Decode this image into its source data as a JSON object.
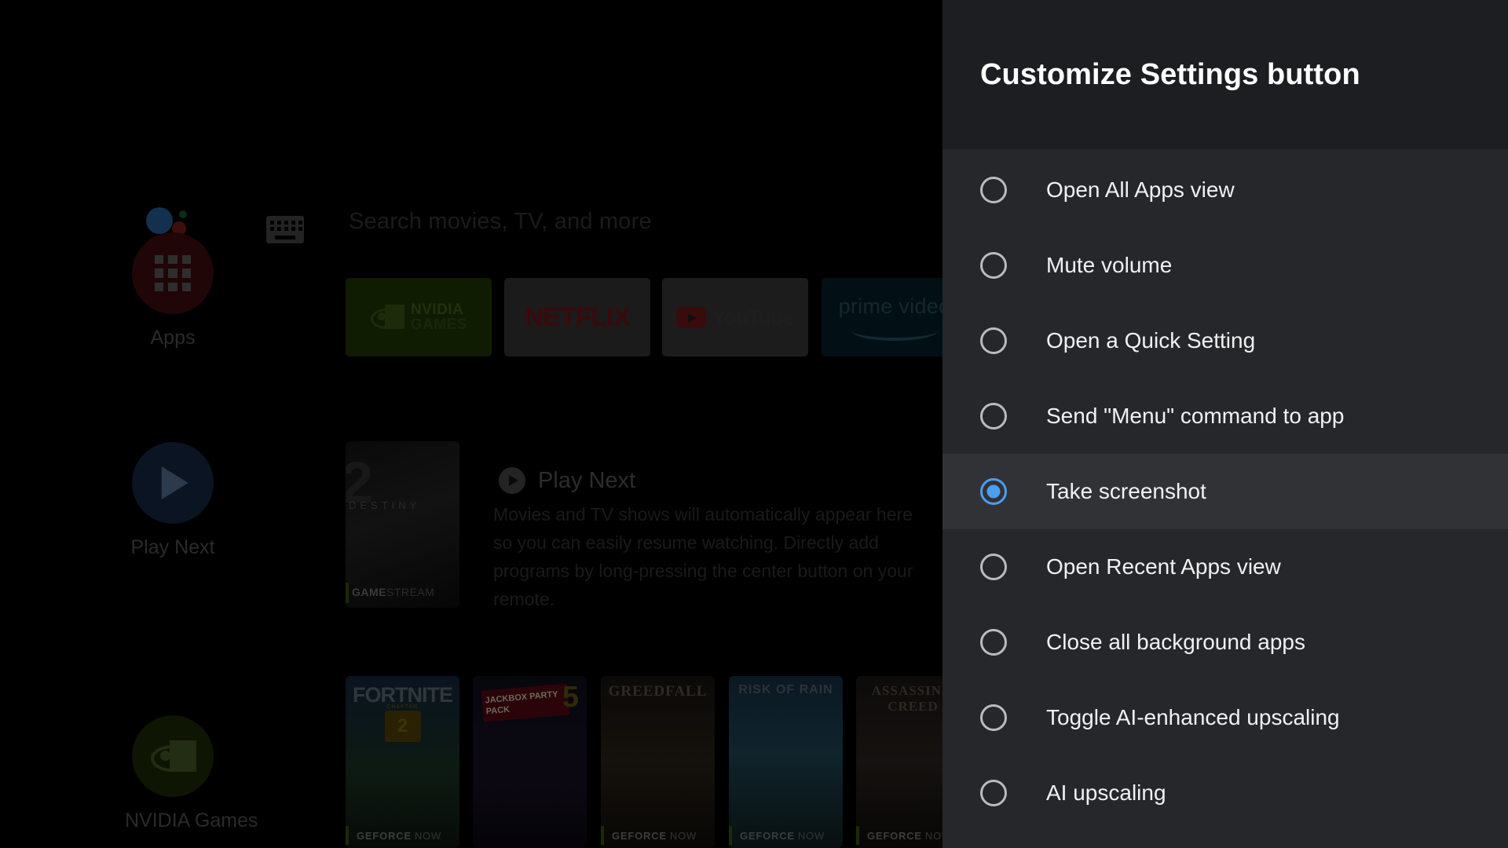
{
  "panel": {
    "title": "Customize Settings button",
    "options": [
      {
        "label": "Open All Apps view",
        "selected": false
      },
      {
        "label": "Mute volume",
        "selected": false
      },
      {
        "label": "Open a Quick Setting",
        "selected": false
      },
      {
        "label": "Send \"Menu\" command to app",
        "selected": false
      },
      {
        "label": "Take screenshot",
        "selected": true
      },
      {
        "label": "Open Recent Apps view",
        "selected": false
      },
      {
        "label": "Close all background apps",
        "selected": false
      },
      {
        "label": "Toggle AI-enhanced upscaling",
        "selected": false
      },
      {
        "label": "AI upscaling",
        "selected": false
      }
    ],
    "accent_color": "#4c9dee",
    "header_bg": "#1d1e21",
    "list_bg": "#26272b",
    "selected_row_bg": "#313236"
  },
  "tv_home": {
    "search": {
      "placeholder": "Search movies, TV, and more",
      "assistant_icon": "google-assistant-icon",
      "keyboard_icon": "keyboard-icon"
    },
    "rail": [
      {
        "label": "Apps",
        "icon": "apps-grid-icon"
      },
      {
        "label": "Play Next",
        "icon": "play-triangle-icon"
      },
      {
        "label": "NVIDIA Games",
        "icon": "nvidia-eye-icon"
      }
    ],
    "app_tiles": [
      {
        "name": "NVIDIA GAMES",
        "line1": "NVIDIA",
        "line2": "GAMES"
      },
      {
        "name": "NETFLIX",
        "wordmark": "NETFLIX"
      },
      {
        "name": "YouTube",
        "wordmark": "YouTube"
      },
      {
        "name": "prime video",
        "wordmark": "prime video"
      }
    ],
    "play_next": {
      "title": "Play Next",
      "description": "Movies and TV shows will automatically appear here so you can easily resume watching. Directly add programs by long-pressing the center button on your remote.",
      "poster": {
        "number": "2",
        "wordmark": "DESTINY",
        "footer_prefix": "GAME",
        "footer_bold": "STREAM"
      }
    },
    "game_posters": [
      {
        "title": "FORTNITE",
        "chapter_label": "CHAPTER",
        "chapter_number": "2",
        "footer_prefix": "GEFORCE",
        "footer_suffix": "NOW"
      },
      {
        "title": "JACKBOX PARTY PACK",
        "number": "5",
        "footer_prefix": "",
        "footer_suffix": ""
      },
      {
        "title": "GREEDFALL",
        "footer_prefix": "GEFORCE",
        "footer_suffix": "NOW"
      },
      {
        "title": "RISK OF RAIN",
        "footer_prefix": "GEFORCE",
        "footer_suffix": "NOW"
      },
      {
        "title": "ASSASSIN'S CREED",
        "footer_prefix": "GEFORCE",
        "footer_suffix": "NOW"
      }
    ]
  }
}
